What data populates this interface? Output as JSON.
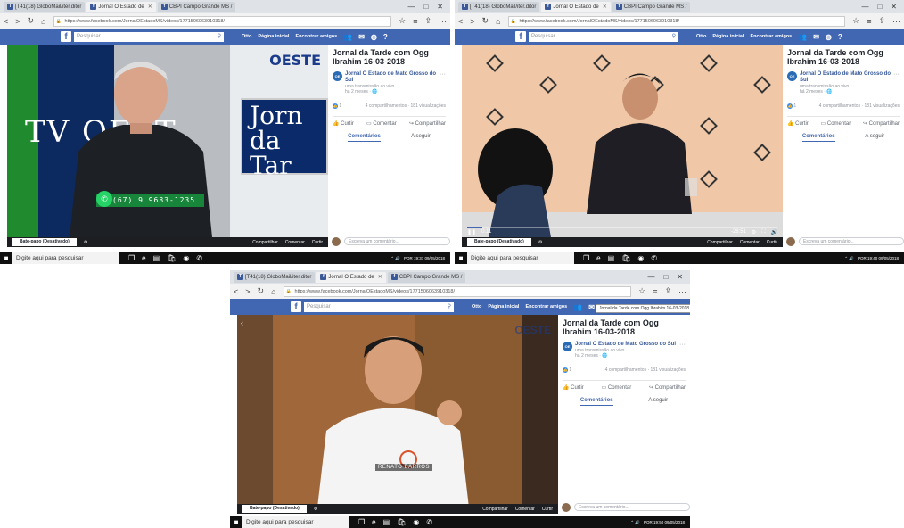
{
  "browser": {
    "tabs": [
      "[T41(18) GloboMail/iter.ditor",
      "Jornal O Estado de",
      "CBPI Campo Grande MS /"
    ],
    "window_controls": [
      "—",
      "□",
      "✕"
    ],
    "url": "https://www.facebook.com/JornalOEstadoMS/videos/1771506063910318/",
    "nav": [
      "<",
      ">",
      "↻",
      "⌂"
    ]
  },
  "facebook": {
    "logo": "f",
    "search_placeholder": "Pesquisar",
    "nav_items": [
      "Otto",
      "Página inicial",
      "Encontrar amigos"
    ],
    "nav_icons": [
      "friends-icon",
      "messenger-icon",
      "globe-icon",
      "help-icon"
    ]
  },
  "post": {
    "title": "Jornal da Tarde com Ogg Ibrahim 16-03-2018",
    "page_name": "Jornal O Estado de Mato Grosso do Sul",
    "page_sub": "uma transmissão ao vivo.",
    "time": "há 2 meses · 🌐",
    "reactions": "1",
    "stats": "4 compartilhamentos · 181 visualizações",
    "actions": [
      "Curtir",
      "Comentar",
      "Compartilhar"
    ],
    "tabs": [
      "Comentários",
      "A seguir"
    ]
  },
  "video_bar": {
    "chat_label": "Bate-papo (Desativado)",
    "actions": [
      "Compartilhar",
      "Comentar",
      "Curtir"
    ]
  },
  "comment_placeholder": "Escreva um comentário...",
  "screens": {
    "one": {
      "phone": "(67) 9 9683-1235",
      "oeste": "TV OEST",
      "jornal": "Jorn da Tar",
      "logo": "OESTE",
      "tray": "POR 19:37 09/05/2018",
      "tooltip": ""
    },
    "two": {
      "time": "0:11",
      "duration": "-28:51",
      "progress": 0.05,
      "tray": "POR 19:40 09/05/2018"
    },
    "three": {
      "badge": "RENATO BARROS",
      "tray": "POR 19:50 09/05/2018",
      "tooltip": "Jornal da Tarde com Ogg Ibrahim 16-03-2018"
    }
  },
  "taskbar": {
    "search": "Digite aqui para pesquisar",
    "start": "■"
  }
}
